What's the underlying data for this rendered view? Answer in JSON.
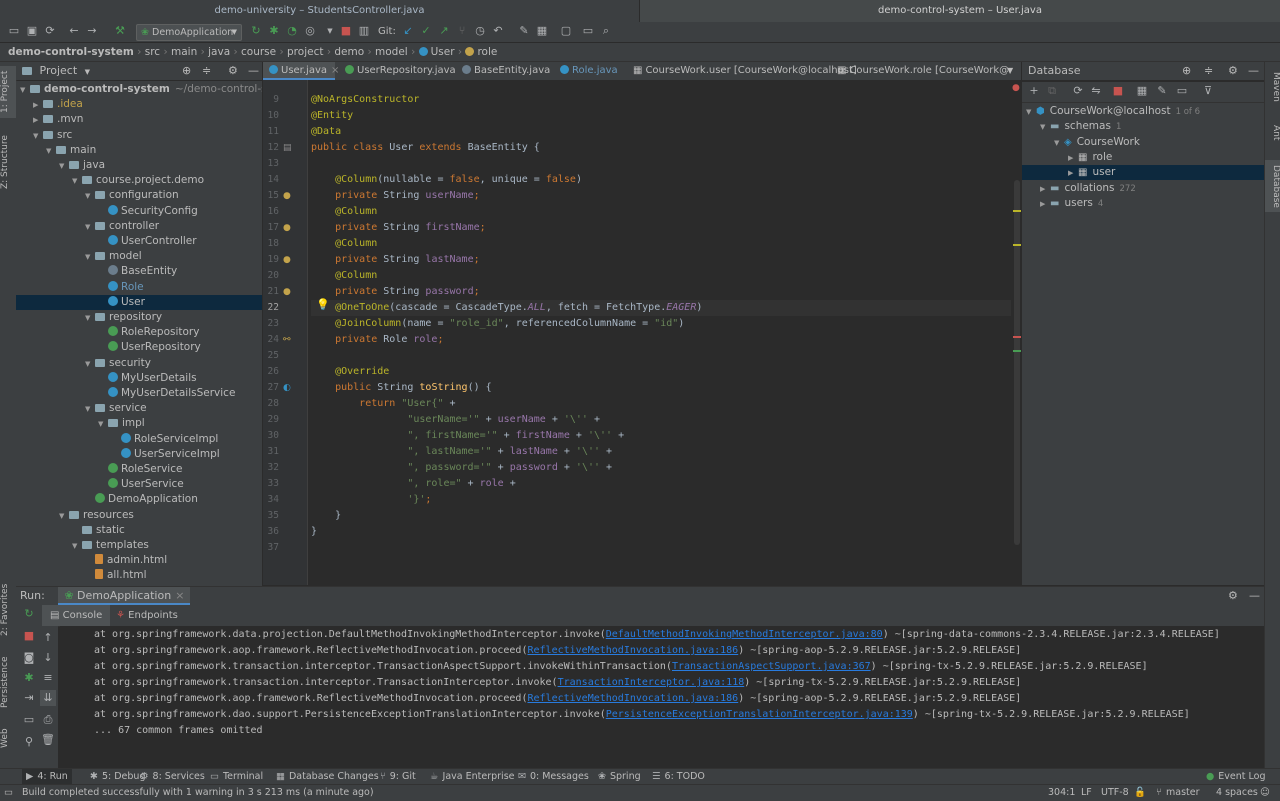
{
  "window_tabs": [
    "demo-university – StudentsController.java",
    "demo-control-system – User.java"
  ],
  "toolbar": {
    "run_config": "DemoApplication",
    "git_label": "Git:"
  },
  "breadcrumb": [
    "demo-control-system",
    "src",
    "main",
    "java",
    "course",
    "project",
    "demo",
    "model",
    "User",
    "role"
  ],
  "left_strip": [
    "1: Project",
    "Z: Structure",
    "2: Favorites",
    "Persistence",
    "Web"
  ],
  "right_strip": [
    "Maven",
    "Ant",
    "Database"
  ],
  "project": {
    "title": "Project",
    "tree": [
      {
        "label": "demo-control-system",
        "suffix": "~/demo-control-syste",
        "level": 0,
        "arrow": "▼",
        "kind": "folder",
        "bold": true
      },
      {
        "label": ".idea",
        "level": 1,
        "arrow": "▶",
        "kind": "folder",
        "color": "#c3a34b"
      },
      {
        "label": ".mvn",
        "level": 1,
        "arrow": "▶",
        "kind": "folder"
      },
      {
        "label": "src",
        "level": 1,
        "arrow": "▼",
        "kind": "folder"
      },
      {
        "label": "main",
        "level": 2,
        "arrow": "▼",
        "kind": "folder"
      },
      {
        "label": "java",
        "level": 3,
        "arrow": "▼",
        "kind": "folder"
      },
      {
        "label": "course.project.demo",
        "level": 4,
        "arrow": "▼",
        "kind": "folder"
      },
      {
        "label": "configuration",
        "level": 5,
        "arrow": "▼",
        "kind": "folder"
      },
      {
        "label": "SecurityConfig",
        "level": 6,
        "kind": "class"
      },
      {
        "label": "controller",
        "level": 5,
        "arrow": "▼",
        "kind": "folder"
      },
      {
        "label": "UserController",
        "level": 6,
        "kind": "class"
      },
      {
        "label": "model",
        "level": 5,
        "arrow": "▼",
        "kind": "folder"
      },
      {
        "label": "BaseEntity",
        "level": 6,
        "kind": "abstract"
      },
      {
        "label": "Role",
        "level": 6,
        "kind": "class",
        "color": "#6897bb"
      },
      {
        "label": "User",
        "level": 6,
        "kind": "class",
        "selected": true
      },
      {
        "label": "repository",
        "level": 5,
        "arrow": "▼",
        "kind": "folder"
      },
      {
        "label": "RoleRepository",
        "level": 6,
        "kind": "interface"
      },
      {
        "label": "UserRepository",
        "level": 6,
        "kind": "interface"
      },
      {
        "label": "security",
        "level": 5,
        "arrow": "▼",
        "kind": "folder"
      },
      {
        "label": "MyUserDetails",
        "level": 6,
        "kind": "class"
      },
      {
        "label": "MyUserDetailsService",
        "level": 6,
        "kind": "class"
      },
      {
        "label": "service",
        "level": 5,
        "arrow": "▼",
        "kind": "folder"
      },
      {
        "label": "impl",
        "level": 6,
        "arrow": "▼",
        "kind": "folder"
      },
      {
        "label": "RoleServiceImpl",
        "level": 7,
        "kind": "class"
      },
      {
        "label": "UserServiceImpl",
        "level": 7,
        "kind": "class"
      },
      {
        "label": "RoleService",
        "level": 6,
        "kind": "interface"
      },
      {
        "label": "UserService",
        "level": 6,
        "kind": "interface"
      },
      {
        "label": "DemoApplication",
        "level": 5,
        "kind": "spring"
      },
      {
        "label": "resources",
        "level": 3,
        "arrow": "▼",
        "kind": "folder"
      },
      {
        "label": "static",
        "level": 4,
        "kind": "folder"
      },
      {
        "label": "templates",
        "level": 4,
        "arrow": "▼",
        "kind": "folder"
      },
      {
        "label": "admin.html",
        "level": 5,
        "kind": "html"
      },
      {
        "label": "all.html",
        "level": 5,
        "kind": "html"
      }
    ]
  },
  "editor_tabs": [
    {
      "label": "User.java",
      "active": true
    },
    {
      "label": "UserRepository.java"
    },
    {
      "label": "BaseEntity.java"
    },
    {
      "label": "Role.java"
    },
    {
      "label": "CourseWork.user [CourseWork@localhost]"
    },
    {
      "label": "CourseWork.role [CourseWork@localhos"
    }
  ],
  "editor": {
    "current_line": 22,
    "lines": [
      {
        "n": "9",
        "tokens": [
          [
            "an",
            "@NoArgsConstructor"
          ]
        ]
      },
      {
        "n": "10",
        "tokens": [
          [
            "an",
            "@Entity"
          ]
        ]
      },
      {
        "n": "11",
        "tokens": [
          [
            "an",
            "@Data"
          ]
        ]
      },
      {
        "n": "12",
        "tokens": [
          [
            "kw",
            "public class "
          ],
          [
            "",
            "User "
          ],
          [
            "kw",
            "extends "
          ],
          [
            "",
            "BaseEntity {"
          ]
        ]
      },
      {
        "n": "13",
        "tokens": []
      },
      {
        "n": "14",
        "tokens": [
          [
            "",
            "    "
          ],
          [
            "an",
            "@Column"
          ],
          [
            "",
            "(nullable = "
          ],
          [
            "kw",
            "false"
          ],
          [
            "",
            ", unique = "
          ],
          [
            "kw",
            "false"
          ],
          [
            "",
            ")"
          ]
        ]
      },
      {
        "n": "15",
        "tokens": [
          [
            "",
            "    "
          ],
          [
            "kw",
            "private "
          ],
          [
            "",
            "String "
          ],
          [
            "fd",
            "userName"
          ],
          [
            "kw",
            ";"
          ]
        ]
      },
      {
        "n": "16",
        "tokens": [
          [
            "",
            "    "
          ],
          [
            "an",
            "@Column"
          ]
        ]
      },
      {
        "n": "17",
        "tokens": [
          [
            "",
            "    "
          ],
          [
            "kw",
            "private "
          ],
          [
            "",
            "String "
          ],
          [
            "fd",
            "firstName"
          ],
          [
            "kw",
            ";"
          ]
        ]
      },
      {
        "n": "18",
        "tokens": [
          [
            "",
            "    "
          ],
          [
            "an",
            "@Column"
          ]
        ]
      },
      {
        "n": "19",
        "tokens": [
          [
            "",
            "    "
          ],
          [
            "kw",
            "private "
          ],
          [
            "",
            "String "
          ],
          [
            "fd",
            "lastName"
          ],
          [
            "kw",
            ";"
          ]
        ]
      },
      {
        "n": "20",
        "tokens": [
          [
            "",
            "    "
          ],
          [
            "an",
            "@Column"
          ]
        ]
      },
      {
        "n": "21",
        "tokens": [
          [
            "",
            "    "
          ],
          [
            "kw",
            "private "
          ],
          [
            "",
            "String "
          ],
          [
            "fd",
            "password"
          ],
          [
            "kw",
            ";"
          ]
        ]
      },
      {
        "n": "22",
        "tokens": [
          [
            "",
            "    "
          ],
          [
            "an",
            "@OneToOne"
          ],
          [
            "",
            "(cascade = CascadeType."
          ],
          [
            "it",
            "ALL"
          ],
          [
            "",
            ", fetch = FetchType."
          ],
          [
            "it",
            "EAGER"
          ],
          [
            "",
            ")"
          ]
        ]
      },
      {
        "n": "23",
        "tokens": [
          [
            "",
            "    "
          ],
          [
            "an",
            "@JoinColumn"
          ],
          [
            "",
            "(name = "
          ],
          [
            "st",
            "\"role_id\""
          ],
          [
            "",
            ", referencedColumnName = "
          ],
          [
            "st",
            "\"id\""
          ],
          [
            "",
            ")"
          ]
        ]
      },
      {
        "n": "24",
        "tokens": [
          [
            "",
            "    "
          ],
          [
            "kw",
            "private "
          ],
          [
            "",
            "Role "
          ],
          [
            "fd",
            "role"
          ],
          [
            "kw",
            ";"
          ]
        ]
      },
      {
        "n": "25",
        "tokens": []
      },
      {
        "n": "26",
        "tokens": [
          [
            "",
            "    "
          ],
          [
            "an",
            "@Override"
          ]
        ]
      },
      {
        "n": "27",
        "tokens": [
          [
            "",
            "    "
          ],
          [
            "kw",
            "public "
          ],
          [
            "",
            "String "
          ],
          [
            "fn",
            "toString"
          ],
          [
            "",
            "() {"
          ]
        ]
      },
      {
        "n": "28",
        "tokens": [
          [
            "",
            "        "
          ],
          [
            "kw",
            "return "
          ],
          [
            "st",
            "\"User{\""
          ],
          [
            "",
            " +"
          ]
        ]
      },
      {
        "n": "29",
        "tokens": [
          [
            "",
            "                "
          ],
          [
            "st",
            "\"userName='\""
          ],
          [
            "",
            " + "
          ],
          [
            "fd",
            "userName"
          ],
          [
            "",
            " + "
          ],
          [
            "st",
            "'\\''"
          ],
          [
            "",
            " +"
          ]
        ]
      },
      {
        "n": "30",
        "tokens": [
          [
            "",
            "                "
          ],
          [
            "st",
            "\", firstName='\""
          ],
          [
            "",
            " + "
          ],
          [
            "fd",
            "firstName"
          ],
          [
            "",
            " + "
          ],
          [
            "st",
            "'\\''"
          ],
          [
            "",
            " +"
          ]
        ]
      },
      {
        "n": "31",
        "tokens": [
          [
            "",
            "                "
          ],
          [
            "st",
            "\", lastName='\""
          ],
          [
            "",
            " + "
          ],
          [
            "fd",
            "lastName"
          ],
          [
            "",
            " + "
          ],
          [
            "st",
            "'\\''"
          ],
          [
            "",
            " +"
          ]
        ]
      },
      {
        "n": "32",
        "tokens": [
          [
            "",
            "                "
          ],
          [
            "st",
            "\", password='\""
          ],
          [
            "",
            " + "
          ],
          [
            "fd",
            "password"
          ],
          [
            "",
            " + "
          ],
          [
            "st",
            "'\\''"
          ],
          [
            "",
            " +"
          ]
        ]
      },
      {
        "n": "33",
        "tokens": [
          [
            "",
            "                "
          ],
          [
            "st",
            "\", role=\""
          ],
          [
            "",
            " + "
          ],
          [
            "fd",
            "role"
          ],
          [
            "",
            " +"
          ]
        ]
      },
      {
        "n": "34",
        "tokens": [
          [
            "",
            "                "
          ],
          [
            "st",
            "'}'"
          ],
          [
            "kw",
            ";"
          ]
        ]
      },
      {
        "n": "35",
        "tokens": [
          [
            "",
            "    }"
          ]
        ]
      },
      {
        "n": "36",
        "tokens": [
          [
            "",
            "}"
          ]
        ]
      },
      {
        "n": "37",
        "tokens": []
      }
    ]
  },
  "database": {
    "title": "Database",
    "tree": [
      {
        "label": "CourseWork@localhost",
        "badge": "1 of 6",
        "level": 0,
        "arrow": "▼",
        "icon": "datasource"
      },
      {
        "label": "schemas",
        "badge": "1",
        "level": 1,
        "arrow": "▼",
        "icon": "folder"
      },
      {
        "label": "CourseWork",
        "level": 2,
        "arrow": "▼",
        "icon": "schema"
      },
      {
        "label": "role",
        "level": 3,
        "arrow": "▶",
        "icon": "table"
      },
      {
        "label": "user",
        "level": 3,
        "arrow": "▶",
        "icon": "table",
        "selected": true
      },
      {
        "label": "collations",
        "badge": "272",
        "level": 1,
        "arrow": "▶",
        "icon": "folder"
      },
      {
        "label": "users",
        "badge": "4",
        "level": 1,
        "arrow": "▶",
        "icon": "folder"
      }
    ]
  },
  "run": {
    "label": "Run:",
    "config": "DemoApplication",
    "tabs": [
      "Console",
      "Endpoints"
    ],
    "console": [
      {
        "pre": "at org.springframework.data.projection.DefaultMethodInvokingMethodInterceptor.invoke(",
        "link": "DefaultMethodInvokingMethodInterceptor.java:80",
        "post": ") ~[spring-data-commons-2.3.4.RELEASE.jar:2.3.4.RELEASE]"
      },
      {
        "pre": "at org.springframework.aop.framework.ReflectiveMethodInvocation.proceed(",
        "link": "ReflectiveMethodInvocation.java:186",
        "post": ") ~[spring-aop-5.2.9.RELEASE.jar:5.2.9.RELEASE]"
      },
      {
        "pre": "at org.springframework.transaction.interceptor.TransactionAspectSupport.invokeWithinTransaction(",
        "link": "TransactionAspectSupport.java:367",
        "post": ") ~[spring-tx-5.2.9.RELEASE.jar:5.2.9.RELEASE]"
      },
      {
        "pre": "at org.springframework.transaction.interceptor.TransactionInterceptor.invoke(",
        "link": "TransactionInterceptor.java:118",
        "post": ") ~[spring-tx-5.2.9.RELEASE.jar:5.2.9.RELEASE]"
      },
      {
        "pre": "at org.springframework.aop.framework.ReflectiveMethodInvocation.proceed(",
        "link": "ReflectiveMethodInvocation.java:186",
        "post": ") ~[spring-aop-5.2.9.RELEASE.jar:5.2.9.RELEASE]"
      },
      {
        "pre": "at org.springframework.dao.support.PersistenceExceptionTranslationInterceptor.invoke(",
        "link": "PersistenceExceptionTranslationInterceptor.java:139",
        "post": ") ~[spring-tx-5.2.9.RELEASE.jar:5.2.9.RELEASE]"
      },
      {
        "pre": "... 67 common frames omitted",
        "link": "",
        "post": ""
      }
    ]
  },
  "tool_windows": [
    {
      "label": "4: Run",
      "icon": "▶",
      "active": true
    },
    {
      "label": "5: Debug",
      "icon": "✱"
    },
    {
      "label": "8: Services",
      "icon": "⚙"
    },
    {
      "label": "Terminal",
      "icon": "▭"
    },
    {
      "label": "Database Changes",
      "icon": "▦"
    },
    {
      "label": "9: Git",
      "icon": "⑂"
    },
    {
      "label": "Java Enterprise",
      "icon": "☕"
    },
    {
      "label": "0: Messages",
      "icon": "✉"
    },
    {
      "label": "Spring",
      "icon": "❀"
    },
    {
      "label": "6: TODO",
      "icon": "☰"
    },
    {
      "label": "Event Log",
      "icon": "●"
    }
  ],
  "status": {
    "message": "Build completed successfully with 1 warning in 3 s 213 ms (a minute ago)",
    "position": "304:1",
    "line_sep": "LF",
    "encoding": "UTF-8",
    "branch": "master",
    "indent": "4 spaces"
  },
  "colors": {
    "accent": "#4a88c7",
    "selection": "#0d293e",
    "green": "#499c54",
    "red": "#c75450"
  }
}
